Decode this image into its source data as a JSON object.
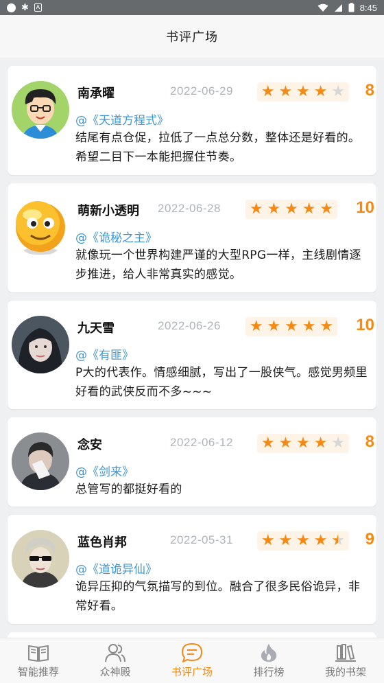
{
  "status_bar": {
    "time": "8:45",
    "icon_a": "A"
  },
  "header": {
    "title": "书评广场"
  },
  "reviews": [
    {
      "user": "南承曜",
      "date": "2022-06-29",
      "rating": 4,
      "score": "8",
      "book": "@《天道方程式》",
      "content": "结尾有点仓促，拉低了一点总分数，整体还是好看的。希望二目下一本能把握住节奏。",
      "avatar": "cartoon-boy-avatar"
    },
    {
      "user": "萌新小透明",
      "date": "2022-06-28",
      "rating": 5,
      "score": "10",
      "book": "@《诡秘之主》",
      "content": "就像玩一个世界构建严谨的大型RPG一样，主线剧情逐步推进，给人非常真实的感觉。",
      "avatar": "emoji-face-avatar"
    },
    {
      "user": "九天雪",
      "date": "2022-06-26",
      "rating": 5,
      "score": "10",
      "book": "@《有匪》",
      "content": "P大的代表作。情感细腻，写出了一股侠气。感觉男频里好看的武侠反而不多~~~",
      "avatar": "girl-photo-avatar"
    },
    {
      "user": "念安",
      "date": "2022-06-12",
      "rating": 4,
      "score": "8",
      "book": "@《剑来》",
      "content": "总管写的都挺好看的",
      "avatar": "boy-photo-avatar"
    },
    {
      "user": "蓝色肖邦",
      "date": "2022-05-31",
      "rating": 4.5,
      "score": "9",
      "book": "@《道诡异仙》",
      "content": "诡异压抑的气氛描写的到位。融合了很多民俗诡异，非常好看。",
      "avatar": "sunglasses-photo-avatar"
    }
  ],
  "tabs": [
    {
      "label": "智能推荐",
      "icon": "book-icon",
      "active": false
    },
    {
      "label": "众神殿",
      "icon": "users-icon",
      "active": false
    },
    {
      "label": "书评广场",
      "icon": "chat-icon",
      "active": true
    },
    {
      "label": "排行榜",
      "icon": "flame-icon",
      "active": false
    },
    {
      "label": "我的书架",
      "icon": "bookshelf-icon",
      "active": false
    }
  ],
  "colors": {
    "accent": "#f48a14",
    "link": "#3f97d4",
    "date": "#aeb4bb",
    "star_bg": "#fdf3e6"
  }
}
